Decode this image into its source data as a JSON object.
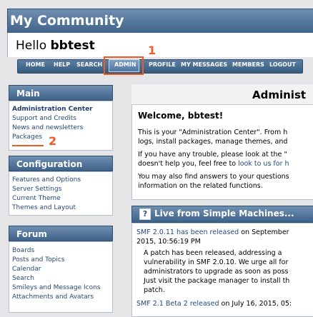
{
  "site": {
    "title": "My Community",
    "hello_prefix": "Hello",
    "username": "bbtest"
  },
  "menu": {
    "items": [
      {
        "label": "HOME"
      },
      {
        "label": "HELP"
      },
      {
        "label": "SEARCH"
      },
      {
        "label": "ADMIN"
      },
      {
        "label": "PROFILE"
      },
      {
        "label": "MY MESSAGES"
      },
      {
        "label": "MEMBERS"
      },
      {
        "label": "LOGOUT"
      }
    ]
  },
  "annotations": {
    "one": "1",
    "two": "2"
  },
  "sidebar": {
    "main": {
      "heading": "Main",
      "items": [
        "Administration Center",
        "Support and Credits",
        "News and newsletters",
        "Packages"
      ]
    },
    "configuration": {
      "heading": "Configuration",
      "items": [
        "Features and Options",
        "Server Settings",
        "Current Theme",
        "Themes and Layout"
      ]
    },
    "forum": {
      "heading": "Forum",
      "items": [
        "Boards",
        "Posts and Topics",
        "Calendar",
        "Search",
        "Smileys and Message Icons",
        "Attachments and Avatars"
      ]
    }
  },
  "main": {
    "title": "Administ",
    "welcome": "Welcome, bbtest!",
    "p1_line1": "This is your \"Administration Center\". From h",
    "p1_line2": "logs, install packages, manage themes, and",
    "p2_line1": "If you have any trouble, please look at the \"",
    "p2_line2_prefix": "doesn't help you, feel free to ",
    "p2_line2_link": "look to us for h",
    "p3_line1": "You may also find answers to your questions",
    "p3_line2": "information on the related functions."
  },
  "live": {
    "icon": "?",
    "title": "Live from Simple Machines...",
    "n1_link": "SMF 2.0.11 has been released",
    "n1_rest": " on September",
    "n1_date": "2015, 10:56:19 PM",
    "n1_body": [
      "A patch has been released, addressing a",
      "vulnerability in SMF 2.0.10. We urge all for",
      "administrators to upgrade as soon as poss",
      "Just visit the package manager to install th",
      "patch."
    ],
    "n2_link": "SMF 2.1 Beta 2 released",
    "n2_rest": " on July 16, 2015, 05:"
  }
}
